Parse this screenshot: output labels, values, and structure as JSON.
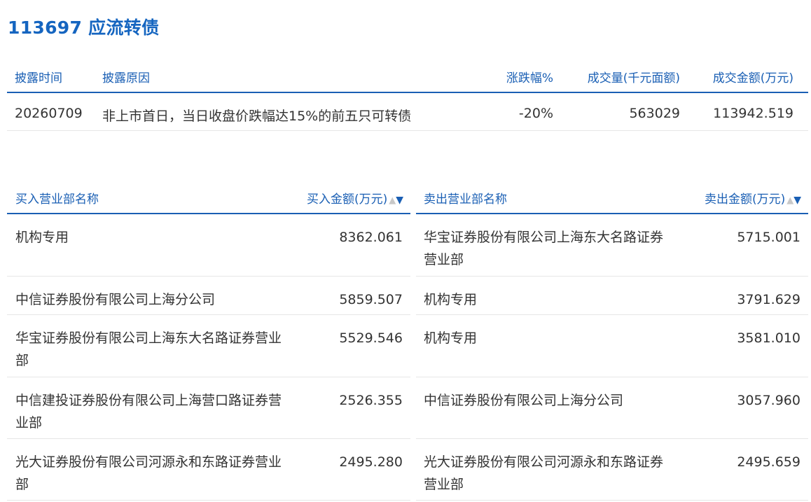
{
  "title": "113697 应流转债",
  "summary": {
    "headers": {
      "date": "披露时间",
      "reason": "披露原因",
      "change": "涨跌幅%",
      "volume": "成交量(千元面额)",
      "amount": "成交金额(万元)"
    },
    "row": {
      "date": "20260709",
      "reason": "非上市首日，当日收盘价跌幅达15%的前五只可转债",
      "change": "-20%",
      "volume": "563029",
      "amount": "113942.519"
    }
  },
  "buy": {
    "header_name": "买入营业部名称",
    "header_amount": "买入金额(万元)",
    "sort_up": "▲",
    "sort_down": "▼",
    "rows": [
      {
        "name": "机构专用",
        "amount": "8362.061"
      },
      {
        "name": "中信证券股份有限公司上海分公司",
        "amount": "5859.507"
      },
      {
        "name": "华宝证券股份有限公司上海东大名路证券营业部",
        "amount": "5529.546"
      },
      {
        "name": "中信建投证券股份有限公司上海营口路证券营业部",
        "amount": "2526.355"
      },
      {
        "name": "光大证券股份有限公司河源永和东路证券营业部",
        "amount": "2495.280"
      }
    ]
  },
  "sell": {
    "header_name": "卖出营业部名称",
    "header_amount": "卖出金额(万元)",
    "sort_up": "▲",
    "sort_down": "▼",
    "rows": [
      {
        "name": "华宝证券股份有限公司上海东大名路证券营业部",
        "amount": "5715.001"
      },
      {
        "name": "机构专用",
        "amount": "3791.629"
      },
      {
        "name": "机构专用",
        "amount": "3581.010"
      },
      {
        "name": "中信证券股份有限公司上海分公司",
        "amount": "3057.960"
      },
      {
        "name": "光大证券股份有限公司河源永和东路证券营业部",
        "amount": "2495.659"
      }
    ]
  }
}
